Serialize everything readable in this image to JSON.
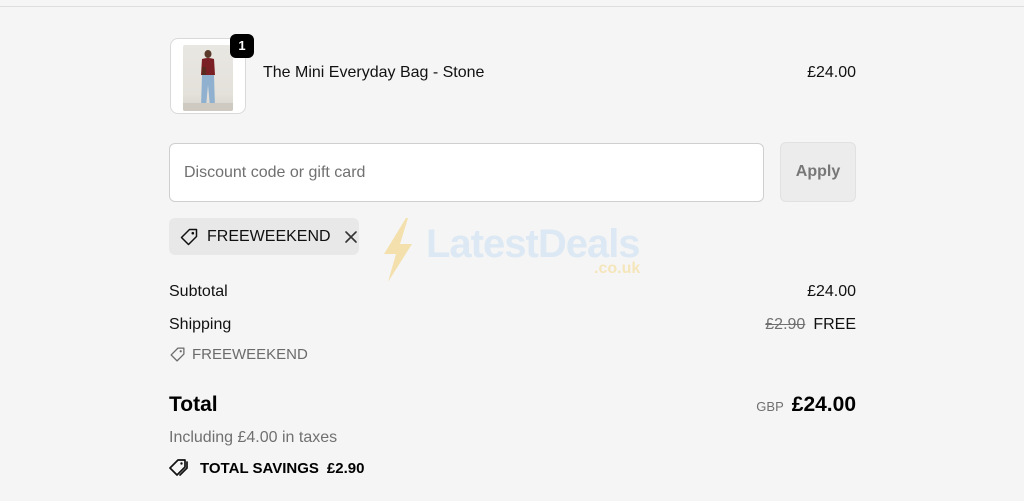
{
  "product": {
    "quantity_badge": "1",
    "name": "The Mini Everyday Bag - Stone",
    "price": "£24.00"
  },
  "discount": {
    "placeholder": "Discount code or gift card",
    "apply_label": "Apply",
    "applied_code": "FREEWEEKEND"
  },
  "summary": {
    "subtotal_label": "Subtotal",
    "subtotal_value": "£24.00",
    "shipping_label": "Shipping",
    "shipping_original": "£2.90",
    "shipping_value": "FREE",
    "shipping_code": "FREEWEEKEND",
    "total_label": "Total",
    "currency": "GBP",
    "total_value": "£24.00",
    "taxes_note": "Including £4.00 in taxes",
    "savings_label": "TOTAL SAVINGS",
    "savings_value": "£2.90"
  },
  "watermark": {
    "text": "LatestDeals",
    "sub": ".co.uk"
  },
  "colors": {
    "background": "#f5f5f5",
    "badge": "#000000",
    "muted": "#707070"
  }
}
